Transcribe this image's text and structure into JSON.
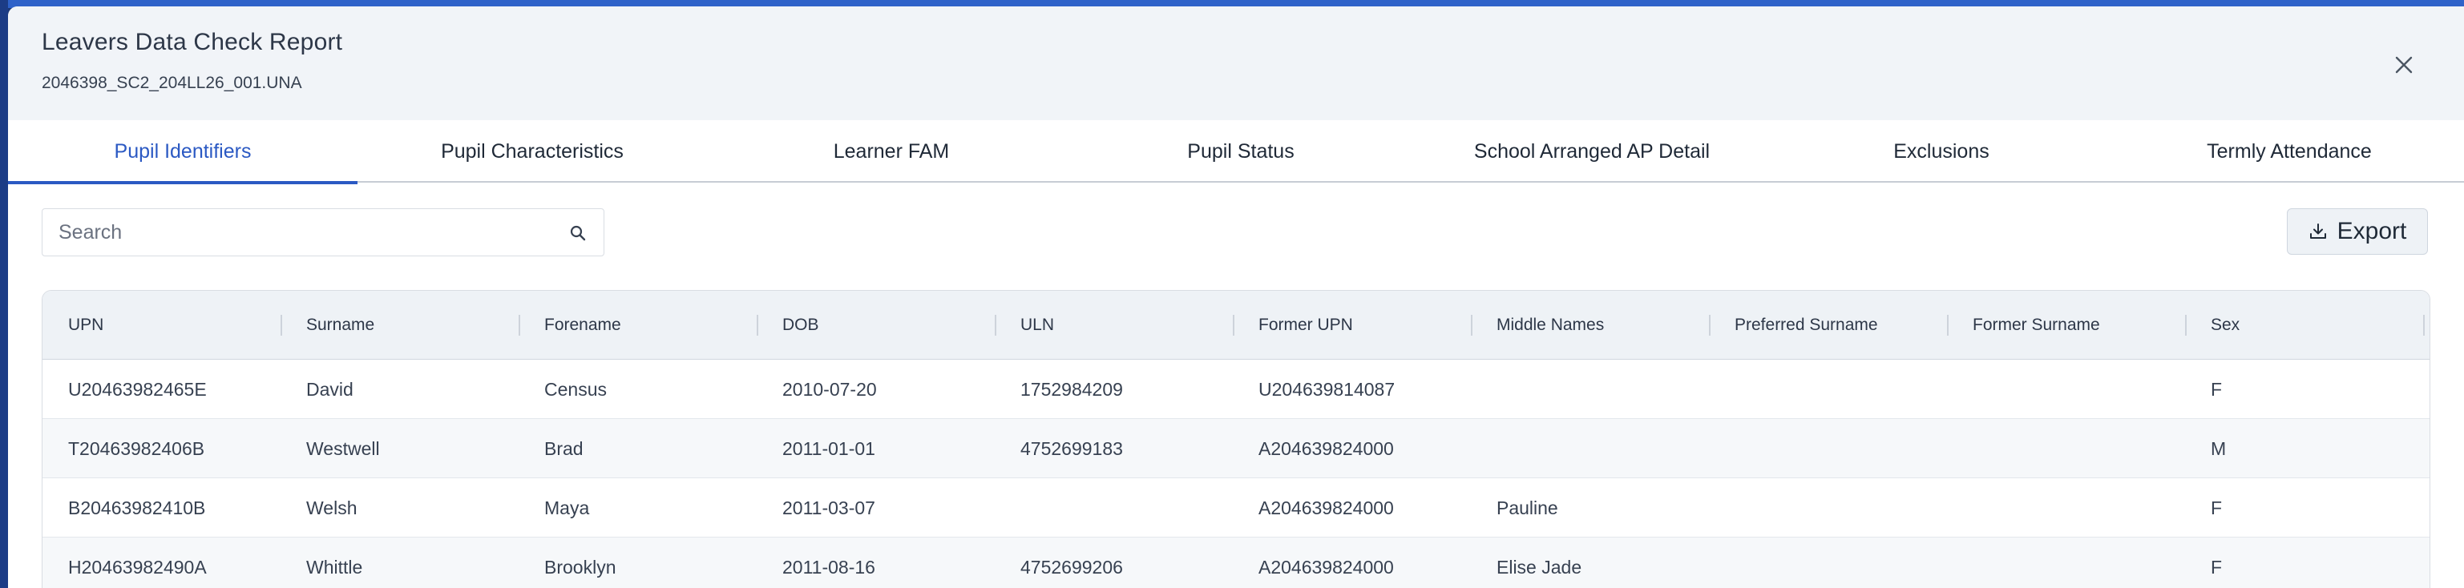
{
  "modal": {
    "title": "Leavers Data Check Report",
    "subtitle": "2046398_SC2_204LL26_001.UNA"
  },
  "tabs": [
    {
      "label": "Pupil Identifiers",
      "active": true
    },
    {
      "label": "Pupil Characteristics",
      "active": false
    },
    {
      "label": "Learner FAM",
      "active": false
    },
    {
      "label": "Pupil Status",
      "active": false
    },
    {
      "label": "School Arranged AP Detail",
      "active": false
    },
    {
      "label": "Exclusions",
      "active": false
    },
    {
      "label": "Termly Attendance",
      "active": false
    }
  ],
  "search": {
    "placeholder": "Search",
    "value": ""
  },
  "export": {
    "label": "Export"
  },
  "table": {
    "columns": [
      "UPN",
      "Surname",
      "Forename",
      "DOB",
      "ULN",
      "Former UPN",
      "Middle Names",
      "Preferred Surname",
      "Former Surname",
      "Sex"
    ],
    "rows": [
      [
        "U20463982465E",
        "David",
        "Census",
        "2010-07-20",
        "1752984209",
        "U204639814087",
        "",
        "",
        "",
        "F"
      ],
      [
        "T20463982406B",
        "Westwell",
        "Brad",
        "2011-01-01",
        "4752699183",
        "A204639824000",
        "",
        "",
        "",
        "M"
      ],
      [
        "B20463982410B",
        "Welsh",
        "Maya",
        "2011-03-07",
        "",
        "A204639824000",
        "Pauline",
        "",
        "",
        "F"
      ],
      [
        "H20463982490A",
        "Whittle",
        "Brooklyn",
        "2011-08-16",
        "4752699206",
        "A204639824000",
        "Elise Jade",
        "",
        "",
        "F"
      ]
    ]
  },
  "colors": {
    "accent": "#2b59c3",
    "header_bg": "#f1f4f8",
    "table_header_bg": "#eef2f6"
  },
  "icons": {
    "close": "close-icon",
    "search": "search-icon",
    "export": "download-icon"
  }
}
